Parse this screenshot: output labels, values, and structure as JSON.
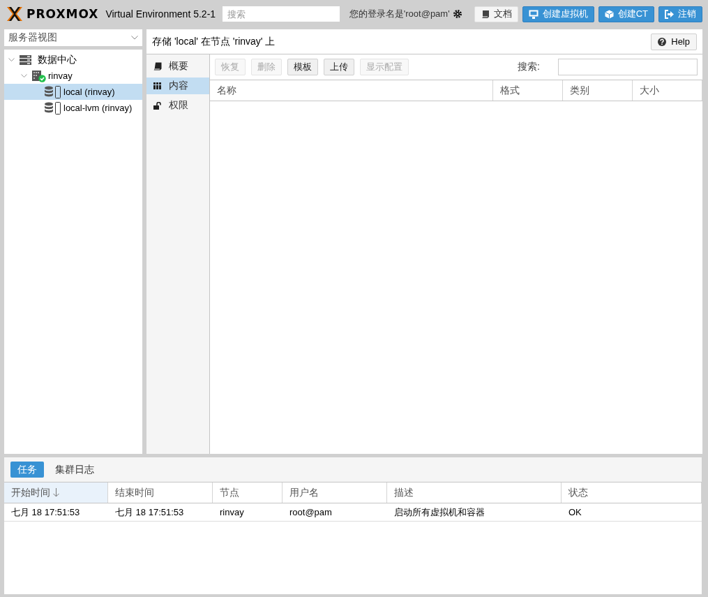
{
  "header": {
    "logo": "PROXMOX",
    "version": "Virtual Environment 5.2-1",
    "search": {
      "placeholder": "搜索"
    },
    "user": "您的登录名是'root@pam'",
    "buttons": [
      {
        "label": "文档",
        "kind": "docs"
      },
      {
        "label": "创建虚拟机",
        "kind": "vm"
      },
      {
        "label": "创建CT",
        "kind": "ct"
      },
      {
        "label": "注销",
        "kind": "logout"
      }
    ]
  },
  "view_selector": {
    "value": "服务器视图"
  },
  "tree": [
    {
      "label": "数据中心",
      "kind": "datacenter",
      "expanded": true,
      "selected": false,
      "children": [
        {
          "label": "rinvay",
          "kind": "node",
          "online": true,
          "expanded": true,
          "selected": false,
          "children": [
            {
              "label": "local (rinvay)",
              "kind": "storage",
              "selected": true
            },
            {
              "label": "local-lvm (rinvay)",
              "kind": "storage",
              "selected": false
            }
          ]
        }
      ]
    }
  ],
  "panel": {
    "title": "存储 'local' 在节点 'rinvay' 上",
    "help": "Help",
    "nav": [
      {
        "label": "概要",
        "kind": "summary",
        "selected": false
      },
      {
        "label": "内容",
        "kind": "content",
        "selected": true
      },
      {
        "label": "权限",
        "kind": "permissions",
        "selected": false
      }
    ],
    "toolbar": {
      "buttons": [
        {
          "label": "恢复",
          "disabled": true
        },
        {
          "label": "删除",
          "disabled": true
        },
        {
          "label": "模板",
          "disabled": false
        },
        {
          "label": "上传",
          "disabled": false
        },
        {
          "label": "显示配置",
          "disabled": true
        }
      ],
      "search_label": "搜索:"
    },
    "columns": [
      "名称",
      "格式",
      "类别",
      "大小"
    ]
  },
  "tasks": {
    "tabs": [
      {
        "label": "任务",
        "selected": true
      },
      {
        "label": "集群日志",
        "selected": false
      }
    ],
    "columns": [
      {
        "label": "开始时间",
        "sorted": true
      },
      {
        "label": "结束时间",
        "sorted": false
      },
      {
        "label": "节点",
        "sorted": false
      },
      {
        "label": "用户名",
        "sorted": false
      },
      {
        "label": "描述",
        "sorted": false
      },
      {
        "label": "状态",
        "sorted": false
      }
    ],
    "rows": [
      [
        "七月 18 17:51:53",
        "七月 18 17:51:53",
        "rinvay",
        "root@pam",
        "启动所有虚拟机和容器",
        "OK"
      ]
    ]
  }
}
